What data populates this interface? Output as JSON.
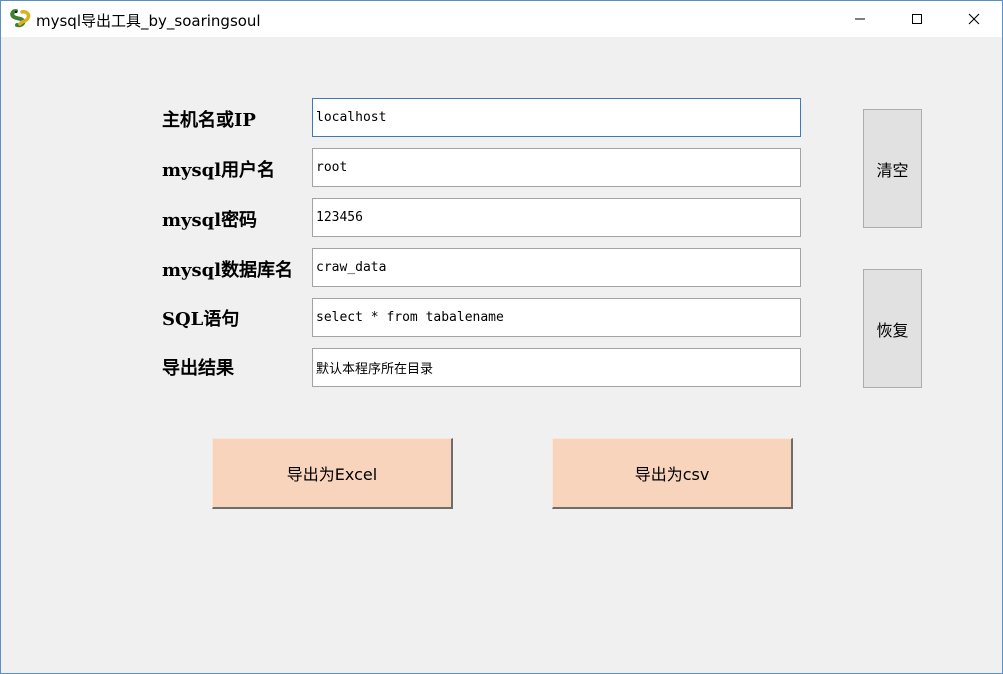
{
  "window": {
    "title": "mysql导出工具_by_soaringsoul",
    "app_icon": "python-snake-icon",
    "controls": {
      "minimize": "minimize-icon",
      "maximize": "maximize-icon",
      "close": "close-icon"
    }
  },
  "form": {
    "fields": [
      {
        "label": "主机名或IP",
        "value": "localhost"
      },
      {
        "label": "mysql用户名",
        "value": "root"
      },
      {
        "label": "mysql密码",
        "value": "123456"
      },
      {
        "label": "mysql数据库名",
        "value": "craw_data"
      },
      {
        "label": "SQL语句",
        "value": "select * from tabalename"
      },
      {
        "label": "导出结果",
        "value": "默认本程序所在目录"
      }
    ]
  },
  "side_buttons": {
    "clear": "清空",
    "restore": "恢复"
  },
  "export_buttons": {
    "excel": "导出为Excel",
    "csv": "导出为csv"
  },
  "colors": {
    "window_bg": "#f0f0f0",
    "export_button_bg": "#f9d4bc",
    "side_button_bg": "#e1e1e1",
    "focus_border": "#3d7ab8"
  }
}
